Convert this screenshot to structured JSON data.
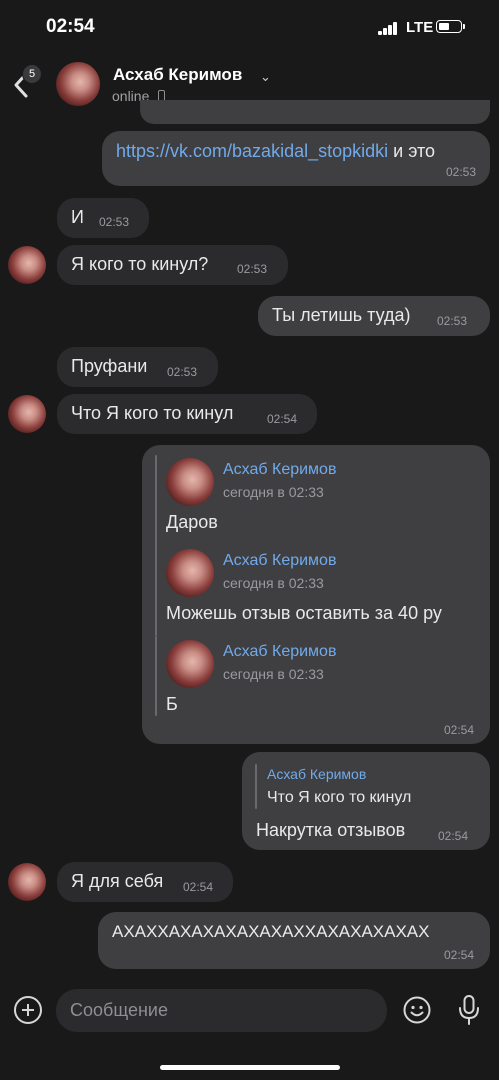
{
  "status_bar": {
    "time": "02:54",
    "network": "LTE"
  },
  "header": {
    "back_badge": "5",
    "name": "Асхаб Керимов",
    "status": "online"
  },
  "messages": {
    "m1": {
      "link": "https://vk.com/bazakidal_stopkidki",
      "text": " и это",
      "time": "02:53"
    },
    "m2": {
      "text": "И",
      "time": "02:53"
    },
    "m3": {
      "text": "Я кого то кинул?",
      "time": "02:53"
    },
    "m4": {
      "text": "Ты летишь туда)",
      "time": "02:53"
    },
    "m5": {
      "text": "Пруфани",
      "time": "02:53"
    },
    "m6": {
      "text": "Что Я кого то кинул",
      "time": "02:54"
    },
    "m7": {
      "time": "02:54",
      "forwards": [
        {
          "name": "Асхаб Керимов",
          "date": "сегодня в 02:33",
          "text": "Даров"
        },
        {
          "name": "Асхаб Керимов",
          "date": "сегодня в 02:33",
          "text": "Можешь отзыв оставить за 40 ру"
        },
        {
          "name": "Асхаб Керимов",
          "date": "сегодня в 02:33",
          "text": "Б"
        }
      ]
    },
    "m8": {
      "reply_name": "Асхаб Керимов",
      "reply_text": "Что Я кого то кинул",
      "text": "Накрутка отзывов",
      "time": "02:54"
    },
    "m9": {
      "text": "Я для себя",
      "time": "02:54"
    },
    "m10": {
      "text": "АХАХХАХАХАХАХАХАХХАХАХАХАХАХ",
      "time": "02:54"
    }
  },
  "composer": {
    "placeholder": "Сообщение"
  },
  "icons": [
    "back-chevron-icon",
    "chevron-down-icon",
    "phone-icon",
    "plus-icon",
    "emoji-icon",
    "microphone-icon"
  ]
}
